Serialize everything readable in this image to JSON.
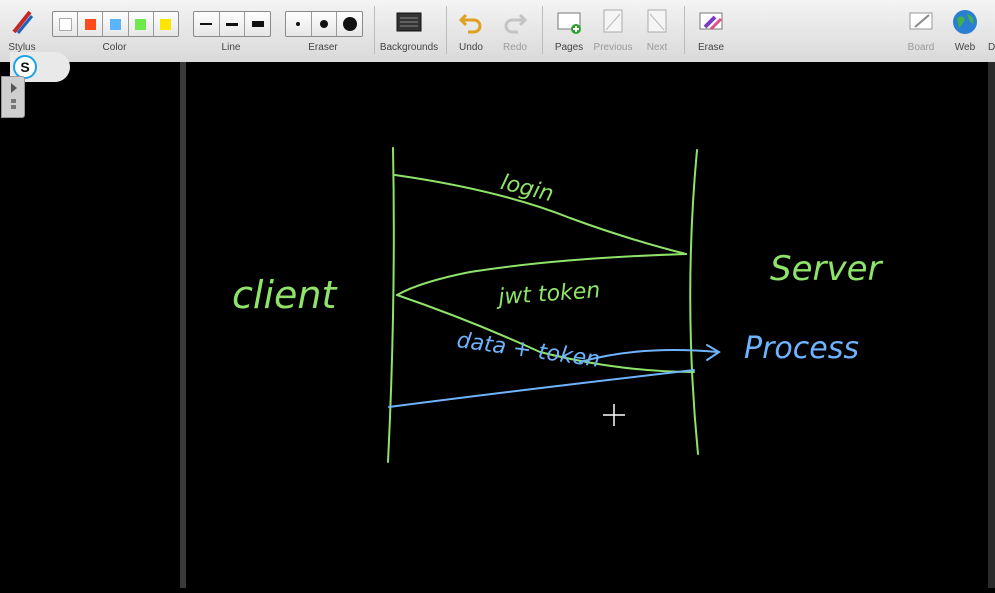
{
  "toolbar": {
    "stylus": "Stylus",
    "color": "Color",
    "line": "Line",
    "eraser": "Eraser",
    "backgrounds": "Backgrounds",
    "undo": "Undo",
    "redo": "Redo",
    "pages": "Pages",
    "previous": "Previous",
    "next": "Next",
    "erase": "Erase",
    "board": "Board",
    "web": "Web",
    "cut_label": "D",
    "colors": [
      "#ffffff",
      "#ff4a1c",
      "#5ab4ff",
      "#6ee84a",
      "#ffe600"
    ]
  },
  "badge": {
    "letter": "S"
  },
  "drawing": {
    "client": "client",
    "server": "Server",
    "login": "login",
    "jwt_token": "jwt token",
    "data_token": "data + token",
    "process": "Process",
    "green_ink": "#8fe36a",
    "blue_ink": "#6fb3ff"
  }
}
